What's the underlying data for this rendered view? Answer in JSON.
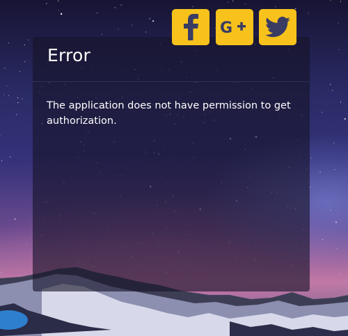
{
  "error_card": {
    "title": "Error",
    "message": "The application does not have permission to get authorization."
  },
  "social": [
    {
      "name": "facebook",
      "icon": "facebook-icon",
      "label": "f"
    },
    {
      "name": "google-plus",
      "icon": "google-plus-icon",
      "label": "G+"
    },
    {
      "name": "twitter",
      "icon": "twitter-icon",
      "label": ""
    }
  ],
  "colors": {
    "accent": "#f7c21b",
    "icon": "#3a3c63",
    "text": "#ffffff"
  }
}
